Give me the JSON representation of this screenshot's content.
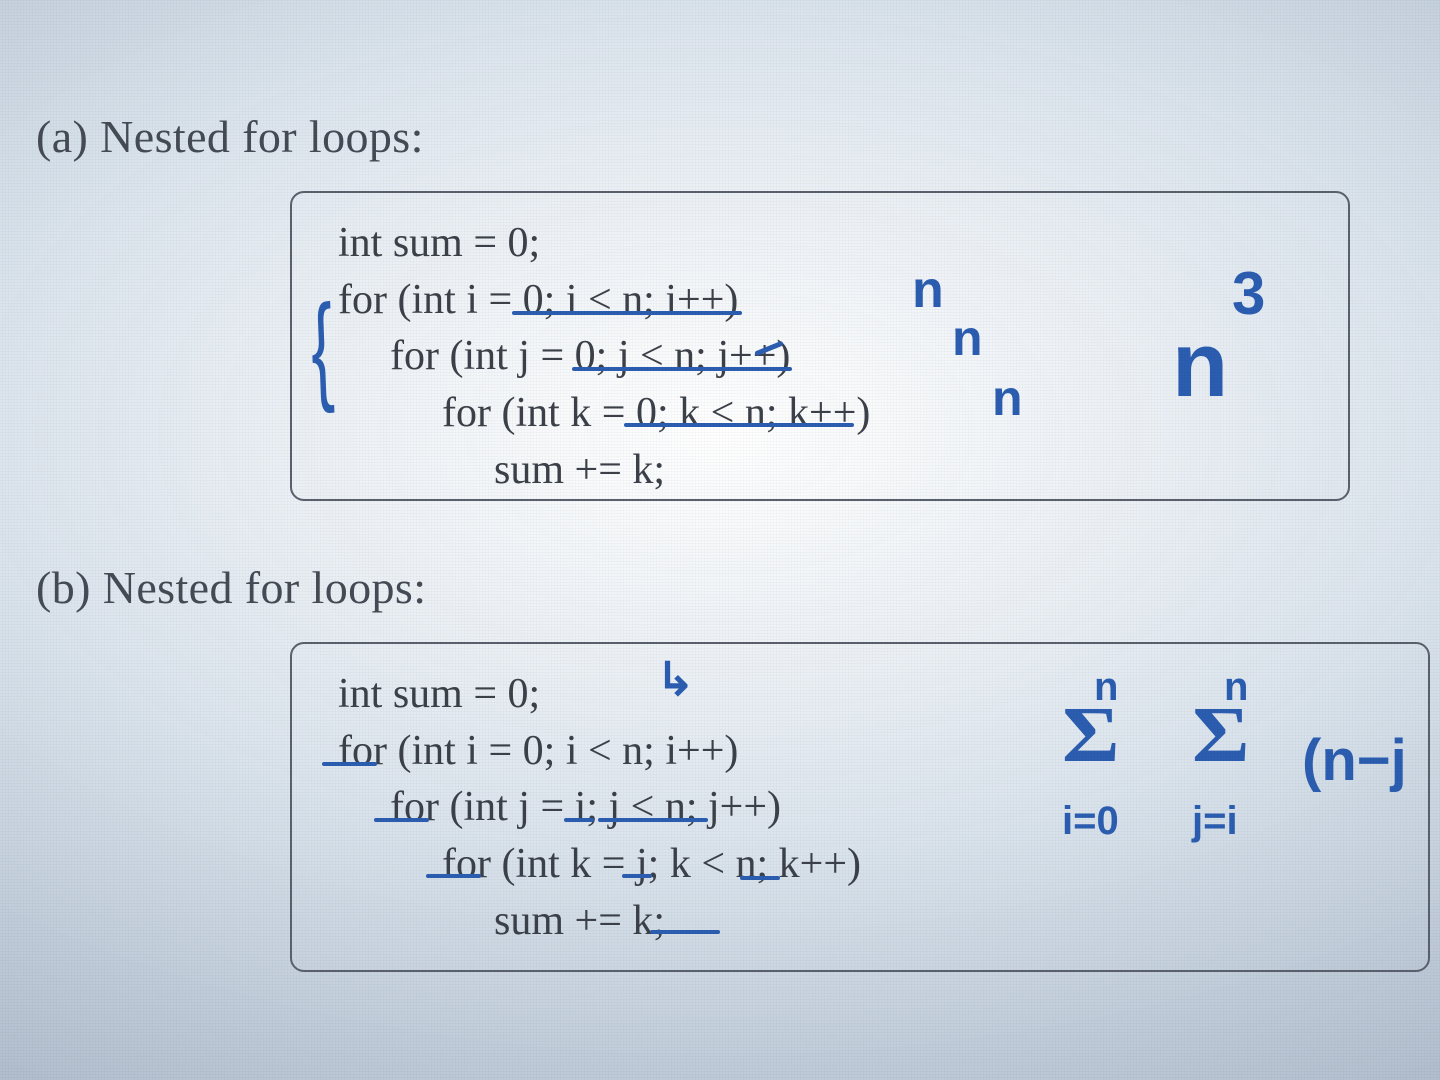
{
  "part_a": {
    "label": "(a)  Nested for loops:",
    "code": {
      "l1": "int sum = 0;",
      "l2": "for (int i = 0; i < n; i++)",
      "l3": "for (int j = 0; j < n; j++)",
      "l4": "for (int k = 0; k < n; k++)",
      "l5": "sum += k;"
    },
    "annot": {
      "n1": "n",
      "n2": "n",
      "n3": "n",
      "result": "n",
      "exp": "3"
    }
  },
  "part_b": {
    "label": "(b)  Nested for loops:",
    "code": {
      "l1": "int sum = 0;",
      "l2": "for (int i = 0; i < n; i++)",
      "l3": "for (int j = i; j < n; j++)",
      "l4": "for (int k = j; k < n; k++)",
      "l5": "sum += k;"
    },
    "annot": {
      "sigma_upper1": "n",
      "sigma_upper2": "n",
      "sigma_lower1": "i=0",
      "sigma_lower2": "j=i",
      "term": "(n−j"
    }
  }
}
